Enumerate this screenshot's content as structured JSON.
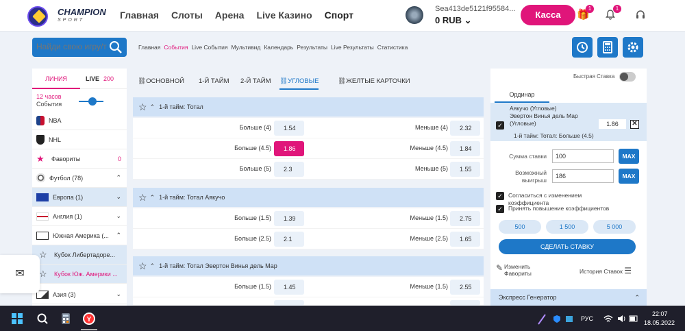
{
  "header": {
    "logo_main": "CHAMPION",
    "logo_sub": "SPORT",
    "nav": [
      "Главная",
      "Слоты",
      "Арена",
      "Live Казино",
      "Спорт"
    ],
    "account_id": "Sea413de5121f95584...",
    "balance": "0 RUB",
    "cashier_label": "Касса",
    "gift_badge": "1",
    "bell_badge": "1"
  },
  "search": {
    "placeholder": "Найди свою игру/т"
  },
  "subnav": [
    "Главная",
    "События",
    "Live События",
    "Мультивид",
    "Календарь",
    "Результаты",
    "Live Результаты",
    "Статистика"
  ],
  "sidebar": {
    "tab_line": "ЛИНИЯ",
    "tab_live": "LIVE",
    "live_count": "200",
    "time_hours": "12 часов",
    "time_events": "События",
    "items": [
      {
        "label": "NBA",
        "right": ""
      },
      {
        "label": "NHL",
        "right": ""
      },
      {
        "label": "Фавориты",
        "right": "0"
      },
      {
        "label": "Футбол (78)",
        "right": ""
      },
      {
        "label": "Европа (1)",
        "right": ""
      },
      {
        "label": "Англия (1)",
        "right": ""
      },
      {
        "label": "Южная Америка (...",
        "right": ""
      },
      {
        "label": "Кубок Либертадоре...",
        "right": ""
      },
      {
        "label": "Кубок Юж. Америки ...",
        "right": ""
      },
      {
        "label": "Азия (3)",
        "right": ""
      }
    ]
  },
  "market_tabs": [
    "ОСНОВНОЙ",
    "1-Й ТАЙМ",
    "2-Й ТАЙМ",
    "УГЛОВЫЕ",
    "ЖЕЛТЫЕ КАРТОЧКИ"
  ],
  "sections": [
    {
      "title": "1-й тайм: Тотал",
      "rows": [
        {
          "l": "Больше (4)",
          "lo": "1.54",
          "r": "Меньше (4)",
          "ro": "2.32"
        },
        {
          "l": "Больше (4.5)",
          "lo": "1.86",
          "r": "Меньше (4.5)",
          "ro": "1.84"
        },
        {
          "l": "Больше (5)",
          "lo": "2.3",
          "r": "Меньше (5)",
          "ro": "1.55"
        }
      ]
    },
    {
      "title": "1-й тайм: Тотал Аякучо",
      "rows": [
        {
          "l": "Больше (1.5)",
          "lo": "1.39",
          "r": "Меньше (1.5)",
          "ro": "2.75"
        },
        {
          "l": "Больше (2.5)",
          "lo": "2.1",
          "r": "Меньше (2.5)",
          "ro": "1.65"
        }
      ]
    },
    {
      "title": "1-й тайм: Тотал Эвертон Винья дель Мар",
      "rows": [
        {
          "l": "Больше (1.5)",
          "lo": "1.45",
          "r": "Меньше (1.5)",
          "ro": "2.55"
        }
      ]
    }
  ],
  "betslip": {
    "quick_bet": "Быстрая Ставка",
    "tab": "Ординар",
    "event_line1": "Аякучо (Угловые)",
    "event_line2": "Эвертон Винья дель Мар",
    "event_line3": "(Угловые)",
    "odd": "1.86",
    "market": "1-й тайм: Тотал: Больше (4.5)",
    "stake_label": "Сумма ставки",
    "stake_value": "100",
    "win_label1": "Возможный",
    "win_label2": "выигрыш",
    "win_value": "186",
    "max_label": "MAX",
    "opt1_line1": "Согласиться с изменением",
    "opt1_line2": "коэффициента",
    "opt2": "Принять повышение коэффициентов",
    "amounts": [
      "500",
      "1 500",
      "5 000"
    ],
    "make_bet": "СДЕЛАТЬ СТАВКУ",
    "edit_fav1": "Изменить",
    "edit_fav2": "Фавориты",
    "history": "История Ставок",
    "express": "Экспресс Генератор"
  },
  "taskbar": {
    "lang": "РУС",
    "time": "22:07",
    "date": "18.05.2022"
  }
}
